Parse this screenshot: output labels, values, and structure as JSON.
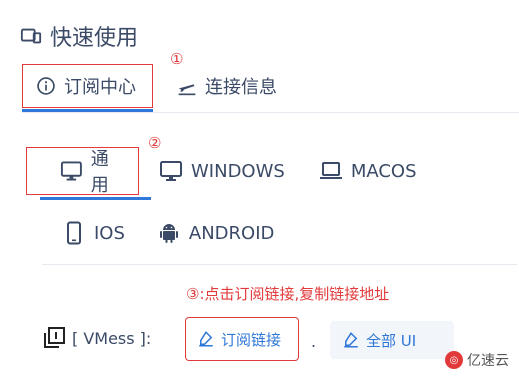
{
  "header": {
    "title": "快速使用",
    "icon": "app-window-icon"
  },
  "tabs": [
    {
      "label": "订阅中心",
      "icon": "info-circle-icon",
      "active": true
    },
    {
      "label": "连接信息",
      "icon": "plane-takeoff-icon",
      "active": false
    }
  ],
  "markers": {
    "one": "①",
    "two": "②"
  },
  "clients_row1": [
    {
      "label": "通用",
      "icon": "monitor-icon"
    },
    {
      "label": "WINDOWS",
      "icon": "monitor-icon"
    },
    {
      "label": "MACOS",
      "icon": "laptop-icon"
    }
  ],
  "clients_row2": [
    {
      "label": "IOS",
      "icon": "phone-icon"
    },
    {
      "label": "ANDROID",
      "icon": "android-icon"
    }
  ],
  "note": "③:点击订阅链接,复制链接地址",
  "vmess": {
    "label": "[ VMess ]:",
    "subscribe_label": "订阅链接",
    "separator": ".",
    "all_label": "全部 UI",
    "icon": "copy-icon"
  },
  "watermark": {
    "text": "亿速云"
  },
  "colors": {
    "accent": "#2f77d8",
    "annotation": "#e23a3a",
    "text": "#3b4a66"
  }
}
